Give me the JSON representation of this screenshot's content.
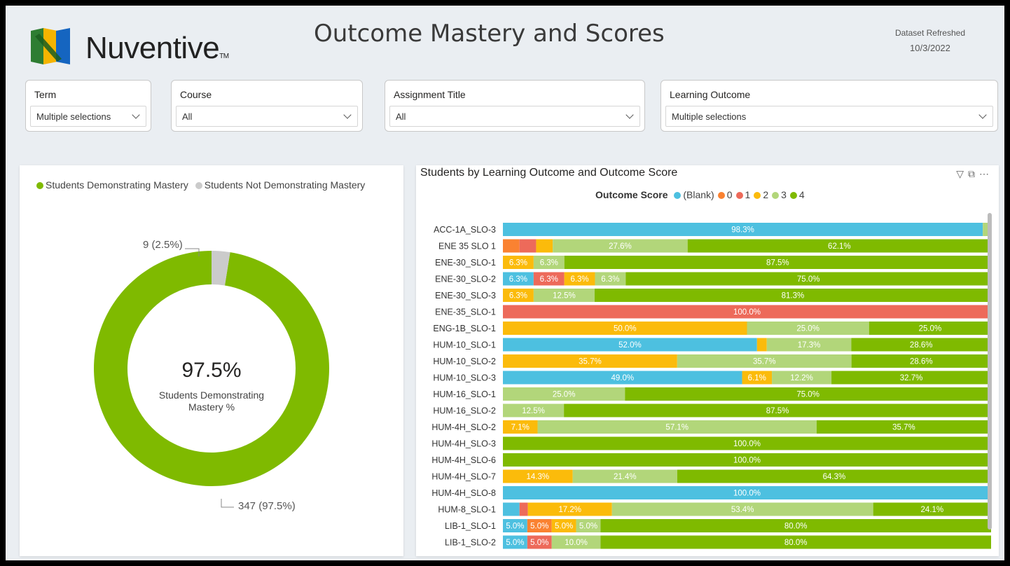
{
  "header": {
    "logo_text": "Nuventive",
    "title": "Outcome Mastery and Scores",
    "refresh_label": "Dataset Refreshed",
    "refresh_date": "10/3/2022"
  },
  "filters": [
    {
      "title": "Term",
      "value": "Multiple selections"
    },
    {
      "title": "Course",
      "value": "All"
    },
    {
      "title": "Assignment Title",
      "value": "All"
    },
    {
      "title": "Learning Outcome",
      "value": "Multiple selections"
    }
  ],
  "colors": {
    "blank": "#4dc0e0",
    "s0": "#fa8231",
    "s1": "#ed6a5a",
    "s2": "#fbbb0b",
    "s3": "#b2d67a",
    "s4": "#7fba00",
    "not_mastery": "#cbcbcb"
  },
  "chart_data": [
    {
      "type": "pie",
      "legend": [
        "Students Demonstrating Mastery",
        "Students Not Demonstrating Mastery"
      ],
      "values": [
        347,
        9
      ],
      "data_labels": [
        "347 (97.5%)",
        "9 (2.5%)"
      ],
      "center_value": "97.5%",
      "center_label": "Students Demonstrating Mastery %"
    },
    {
      "type": "bar",
      "orientation": "horizontal",
      "stacked": "100%",
      "title": "Students by Learning Outcome and Outcome Score",
      "legend_title": "Outcome Score",
      "legend_position": "top-center",
      "series_names": [
        "(Blank)",
        "0",
        "1",
        "2",
        "3",
        "4"
      ],
      "categories": [
        "ACC-1A_SLO-3",
        "ENE 35 SLO 1",
        "ENE-30_SLO-1",
        "ENE-30_SLO-2",
        "ENE-30_SLO-3",
        "ENE-35_SLO-1",
        "ENG-1B_SLO-1",
        "HUM-10_SLO-1",
        "HUM-10_SLO-2",
        "HUM-10_SLO-3",
        "HUM-16_SLO-1",
        "HUM-16_SLO-2",
        "HUM-4H_SLO-2",
        "HUM-4H_SLO-3",
        "HUM-4H_SLO-6",
        "HUM-4H_SLO-7",
        "HUM-4H_SLO-8",
        "HUM-8_SLO-1",
        "LIB-1_SLO-1",
        "LIB-1_SLO-2"
      ],
      "values": [
        [
          98.3,
          0,
          0,
          0,
          1.7,
          0
        ],
        [
          0,
          3.4,
          3.4,
          3.4,
          27.6,
          62.1
        ],
        [
          0,
          0,
          0,
          6.3,
          6.3,
          87.5
        ],
        [
          6.3,
          0,
          6.3,
          6.3,
          6.3,
          75.0
        ],
        [
          0,
          0,
          0,
          6.3,
          12.5,
          81.3
        ],
        [
          0,
          0,
          100.0,
          0,
          0,
          0
        ],
        [
          0,
          0,
          0,
          50.0,
          25.0,
          25.0
        ],
        [
          52.0,
          0,
          0,
          2.0,
          17.3,
          28.6
        ],
        [
          0,
          0,
          0,
          35.7,
          35.7,
          28.6
        ],
        [
          49.0,
          0,
          0,
          6.1,
          12.2,
          32.7
        ],
        [
          0,
          0,
          0,
          0,
          25.0,
          75.0
        ],
        [
          0,
          0,
          0,
          0,
          12.5,
          87.5
        ],
        [
          0,
          0,
          0,
          7.1,
          57.1,
          35.7
        ],
        [
          0,
          0,
          0,
          0,
          0,
          100.0
        ],
        [
          0,
          0,
          0,
          0,
          0,
          100.0
        ],
        [
          0,
          0,
          0,
          14.3,
          21.4,
          64.3
        ],
        [
          100.0,
          0,
          0,
          0,
          0,
          0
        ],
        [
          3.4,
          0,
          1.7,
          17.2,
          53.4,
          24.1
        ],
        [
          5.0,
          5.0,
          0,
          5.0,
          5.0,
          80.0
        ],
        [
          5.0,
          0,
          5.0,
          0,
          10.0,
          80.0
        ]
      ],
      "labels": [
        [
          "98.3%",
          "",
          "",
          "",
          "",
          ""
        ],
        [
          "",
          "",
          "",
          "",
          "27.6%",
          "62.1%"
        ],
        [
          "",
          "",
          "",
          "6.3%",
          "6.3%",
          "87.5%"
        ],
        [
          "6.3%",
          "",
          "6.3%",
          "6.3%",
          "6.3%",
          "75.0%"
        ],
        [
          "",
          "",
          "",
          "6.3%",
          "12.5%",
          "81.3%"
        ],
        [
          "",
          "",
          "100.0%",
          "",
          "",
          ""
        ],
        [
          "",
          "",
          "",
          "50.0%",
          "25.0%",
          "25.0%"
        ],
        [
          "52.0%",
          "",
          "",
          "",
          "17.3%",
          "28.6%"
        ],
        [
          "",
          "",
          "",
          "35.7%",
          "35.7%",
          "28.6%"
        ],
        [
          "49.0%",
          "",
          "",
          "6.1%",
          "12.2%",
          "32.7%"
        ],
        [
          "",
          "",
          "",
          "",
          "25.0%",
          "75.0%"
        ],
        [
          "",
          "",
          "",
          "",
          "12.5%",
          "87.5%"
        ],
        [
          "",
          "",
          "",
          "7.1%",
          "57.1%",
          "35.7%"
        ],
        [
          "",
          "",
          "",
          "",
          "",
          "100.0%"
        ],
        [
          "",
          "",
          "",
          "",
          "",
          "100.0%"
        ],
        [
          "",
          "",
          "",
          "14.3%",
          "21.4%",
          "64.3%"
        ],
        [
          "100.0%",
          "",
          "",
          "",
          "",
          ""
        ],
        [
          "",
          "",
          "",
          "17.2%",
          "53.4%",
          "24.1%"
        ],
        [
          "5.0%",
          "5.0%",
          "",
          "5.0%",
          "5.0%",
          "80.0%"
        ],
        [
          "5.0%",
          "",
          "5.0%",
          "",
          "10.0%",
          "80.0%"
        ]
      ]
    }
  ]
}
